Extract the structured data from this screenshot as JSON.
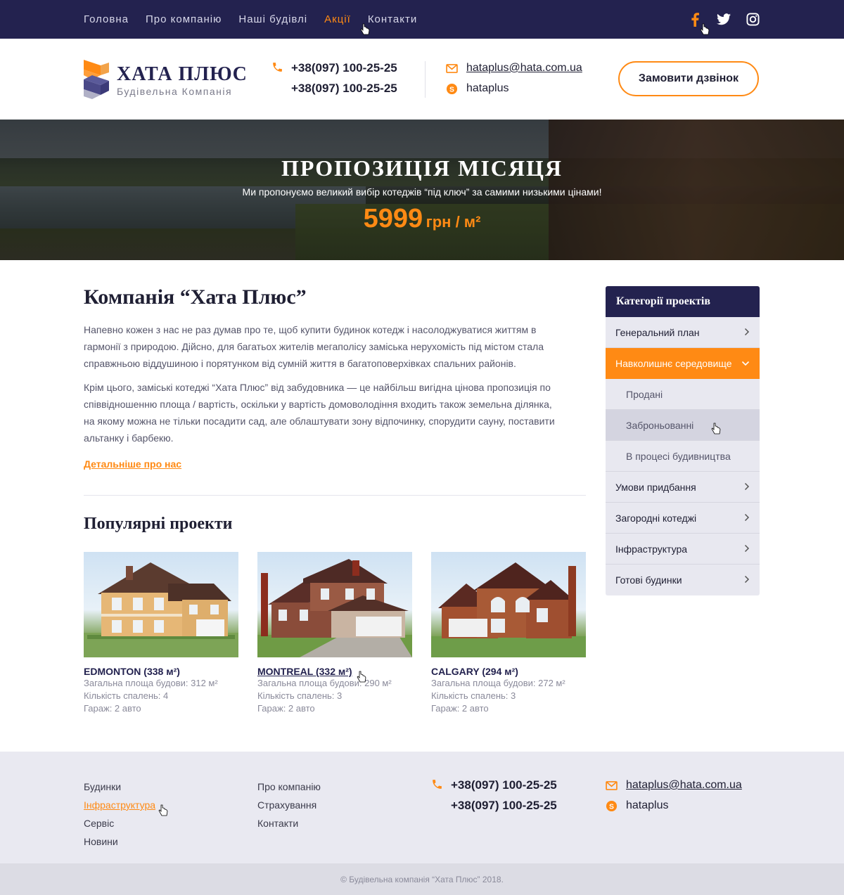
{
  "topnav": {
    "items": [
      {
        "label": "Головна"
      },
      {
        "label": "Про компанію"
      },
      {
        "label": "Наші будівлі"
      },
      {
        "label": "Акції",
        "active": true
      },
      {
        "label": "Контакти"
      }
    ],
    "social": [
      "facebook-icon",
      "twitter-icon",
      "instagram-icon"
    ]
  },
  "header": {
    "logo_title": "ХАТА ПЛЮС",
    "logo_subtitle": "Будівельна Компанія",
    "phone1": "+38(097) 100-25-25",
    "phone2": "+38(097) 100-25-25",
    "email": "hataplus@hata.com.ua",
    "skype": "hataplus",
    "call_button": "Замовити дзвінок"
  },
  "hero": {
    "title": "ПРОПОЗИЦІЯ МІСЯЦЯ",
    "subtitle": "Ми пропонуємо великий вибір котеджів “під ключ” за самими низькими цінами!",
    "price": "5999",
    "unit": "грн / м²"
  },
  "main": {
    "title": "Компанія “Хата Плюс”",
    "para1": "Напевно кожен з нас не раз думав про те, щоб купити будинок котедж і насолоджуватися життям в гармонії з природою. Дійсно, для багатьох жителів мегаполісу заміська нерухомість під містом стала справжньою віддушиною і порятунком від сумній життя в багатоповерхівках спальних районів.",
    "para2": "Крім цього, заміські котеджі “Хата Плюс” від забудовника — це найбільш вигідна цінова пропозиція по співвідношенню площа / вартість, оскільки у вартість домоволодіння входить також земельна ділянка, на якому можна не тільки посадити сад, але облаштувати зону відпочинку, спорудити сауну, поставити альтанку і барбекю.",
    "more_link": "Детальніше про нас",
    "popular_title": "Популярні проекти"
  },
  "projects": [
    {
      "name": "EDMONTON (338 м²)",
      "area": "Загальна площа будови: 312 м²",
      "bedrooms": "Кількість спалень: 4",
      "garage": "Гараж: 2 авто"
    },
    {
      "name": "MONTREAL (332 м²)",
      "area": "Загальна площа будови: 290 м²",
      "bedrooms": "Кількість спалень: 3",
      "garage": "Гараж: 2 авто"
    },
    {
      "name": "CALGARY (294 м²)",
      "area": "Загальна площа будови: 272 м²",
      "bedrooms": "Кількість спалень: 3",
      "garage": "Гараж: 2 авто"
    }
  ],
  "sidebar": {
    "title": "Категорії проектів",
    "items": [
      {
        "label": "Генеральний план"
      },
      {
        "label": "Навколишнє середовище",
        "active": true
      },
      {
        "label": "Продані",
        "sub": true
      },
      {
        "label": "Заброньованні",
        "sub": true
      },
      {
        "label": "В процесі будивництва",
        "sub": true
      },
      {
        "label": "Умови придбання"
      },
      {
        "label": "Загородні котеджі"
      },
      {
        "label": "Інфраструктура"
      },
      {
        "label": "Готові будинки"
      }
    ]
  },
  "footer": {
    "col1": [
      "Будинки",
      "Інфраструктура",
      "Сервіс",
      "Новини"
    ],
    "col2": [
      "Про компанію",
      "Страхування",
      "Контакти"
    ],
    "phone1": "+38(097) 100-25-25",
    "phone2": "+38(097) 100-25-25",
    "email": "hataplus@hata.com.ua",
    "skype": "hataplus",
    "copyright": "© Будівельна компанія “Хата Плюс” 2018."
  },
  "colors": {
    "navy": "#23224f",
    "accent": "#ff8a14",
    "light_bg": "#e9e9f1"
  }
}
